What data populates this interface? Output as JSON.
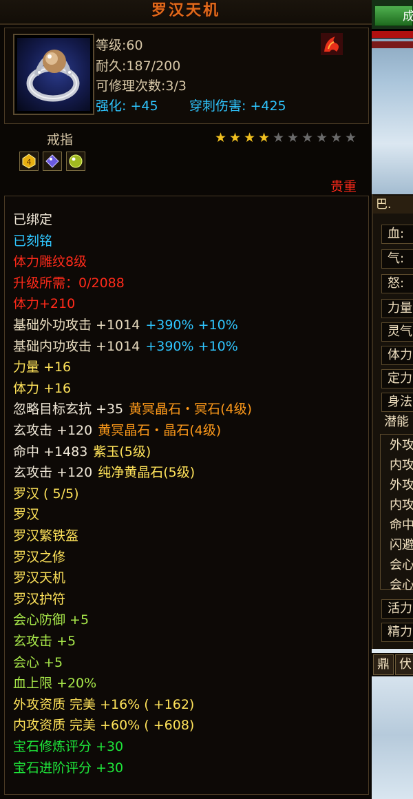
{
  "tooltip": {
    "title": "罗汉天机",
    "stats": {
      "level": "等级:60",
      "durability": "耐久:187/200",
      "repairs": "可修理次数:3/3",
      "enhance": "强化: +45",
      "pierce": "穿刺伤害: +425"
    },
    "item_type": "戒指",
    "star_rating": {
      "filled": 4,
      "total": 10
    },
    "rarity": "贵重",
    "lines": [
      {
        "text": "已绑定",
        "color": "#f0e8d8"
      },
      {
        "text": "已刻铭",
        "color": "#2fc6ff"
      },
      {
        "text": "体力雕纹8级",
        "color": "#ff2a1a"
      },
      {
        "text": "升级所需：0/2088",
        "color": "#ff2a1a"
      },
      {
        "text": "体力+210",
        "color": "#ff2a1a"
      },
      {
        "text": "基础外功攻击 +1014",
        "extra": "+390% +10%",
        "color": "#e8dcc0",
        "extra_color": "#2fc6ff"
      },
      {
        "text": "基础内功攻击 +1014",
        "extra": "+390% +10%",
        "color": "#e8dcc0",
        "extra_color": "#2fc6ff"
      },
      {
        "text": "力量 +16",
        "color": "#ffe35a"
      },
      {
        "text": "体力 +16",
        "color": "#ffe35a"
      },
      {
        "text": "忽略目标玄抗 +35",
        "extra": "黄冥晶石・冥石(4级)",
        "color": "#f0e8d8",
        "extra_color": "#ff9a1a"
      },
      {
        "text": "玄攻击 +120",
        "extra": "黄冥晶石・晶石(4级)",
        "color": "#f0e8d8",
        "extra_color": "#ff9a1a"
      },
      {
        "text": "命中 +1483",
        "extra": "紫玉(5级)",
        "color": "#f0e8d8",
        "extra_color": "#ffe35a"
      },
      {
        "text": "玄攻击 +120",
        "extra": "纯净黄晶石(5级)",
        "color": "#f0e8d8",
        "extra_color": "#ffe35a"
      },
      {
        "text": "罗汉 ( 5/5)",
        "color": "#ffe35a"
      },
      {
        "text": "罗汉",
        "color": "#ffe35a"
      },
      {
        "text": "罗汉繁铁盔",
        "color": "#ffe35a"
      },
      {
        "text": "罗汉之修",
        "color": "#ffe35a"
      },
      {
        "text": "罗汉天机",
        "color": "#ffe35a"
      },
      {
        "text": "罗汉护符",
        "color": "#ffe35a"
      },
      {
        "text": "会心防御 +5",
        "color": "#a8e84a"
      },
      {
        "text": "玄攻击 +5",
        "color": "#a8e84a"
      },
      {
        "text": "会心 +5",
        "color": "#a8e84a"
      },
      {
        "text": "血上限 +20%",
        "color": "#a8e84a"
      },
      {
        "text": "外攻资质  完美 +16% ( +162)",
        "color": "#ffe35a"
      },
      {
        "text": "内攻资质  完美 +60% ( +608)",
        "color": "#ffe35a"
      },
      {
        "text": "宝石修炼评分 +30",
        "color": "#1ee63a"
      },
      {
        "text": "宝石进阶评分 +30",
        "color": "#1ee63a"
      }
    ]
  },
  "side_panel": {
    "top_button": "成",
    "header": "巴.",
    "items": [
      "血:",
      "气:",
      "怒:",
      "力量",
      "灵气",
      "体力",
      "定力",
      "身法",
      "潜能",
      "外攻",
      "内攻",
      "外攻",
      "内攻",
      "命中",
      "闪避",
      "会心",
      "会心",
      "活力",
      "精力"
    ],
    "tabs": [
      "鼎",
      "伏"
    ]
  }
}
